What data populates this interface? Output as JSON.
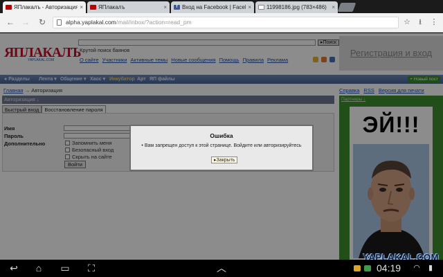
{
  "browser": {
    "tabs": [
      {
        "label": "ЯПлакалъ - Авторизация",
        "icon": "yaplakal-favicon",
        "active": true
      },
      {
        "label": "ЯПлакалъ",
        "icon": "yaplakal-favicon",
        "active": false
      },
      {
        "label": "Вход на Facebook | Facebo",
        "icon": "facebook-favicon",
        "active": false
      },
      {
        "label": "11998186.jpg (783×486)",
        "icon": "image-file-icon",
        "active": false
      }
    ],
    "close_glyph": "×",
    "url_host": "alpha.yaplakal.com",
    "url_path": "/mail/inbox/?action=read_pm"
  },
  "header": {
    "logo": "ЯПЛАКАЛЪ",
    "logo_sub": "YAPLAKAL.COM",
    "search_button": "Поиск",
    "tagline": "Крутой поиск баянов",
    "links": [
      "О сайте",
      "Участники",
      "Активные темы",
      "Новые сообщения",
      "Помощь",
      "Правила",
      "Реклама"
    ],
    "register_login": "Регистрация и вход"
  },
  "navbar": {
    "items": [
      "Разделы",
      "Лента",
      "Общение",
      "Хаос",
      "Инкубатор",
      "Арт",
      "ЯП файлы"
    ],
    "new_post": "Новый пост"
  },
  "breadcrumb": {
    "home": "Главная",
    "arrow": "→",
    "current": "Авторизация"
  },
  "side_links": [
    "Справка",
    "RSS",
    "Версия для печати"
  ],
  "auth": {
    "heading": "Авторизация ↓",
    "tabs": [
      "Быстрый вход",
      "Восстановление пароля"
    ],
    "fields": {
      "name": "Имя",
      "password": "Пароль",
      "extra": "Дополнительно"
    },
    "options": [
      "Запомнить меня",
      "Безопасный вход",
      "Скрыть на сайте"
    ],
    "login_button": "Войти"
  },
  "sidebar": {
    "partners": "Партнеры ↓",
    "ad_text": "ЭЙ!!!"
  },
  "modal": {
    "title": "Ошибка",
    "message": "Вам запрещен доступ к этой странице. Войдите или авторизируйтесь",
    "close_button": "Закрыть"
  },
  "watermark": "YAPLAKAL.COM",
  "system": {
    "time": "04:19"
  },
  "colors": {
    "brand_red": "#c8102e",
    "nav_blue": "#4a6596",
    "sidebar_green": "#3f8f2f"
  }
}
